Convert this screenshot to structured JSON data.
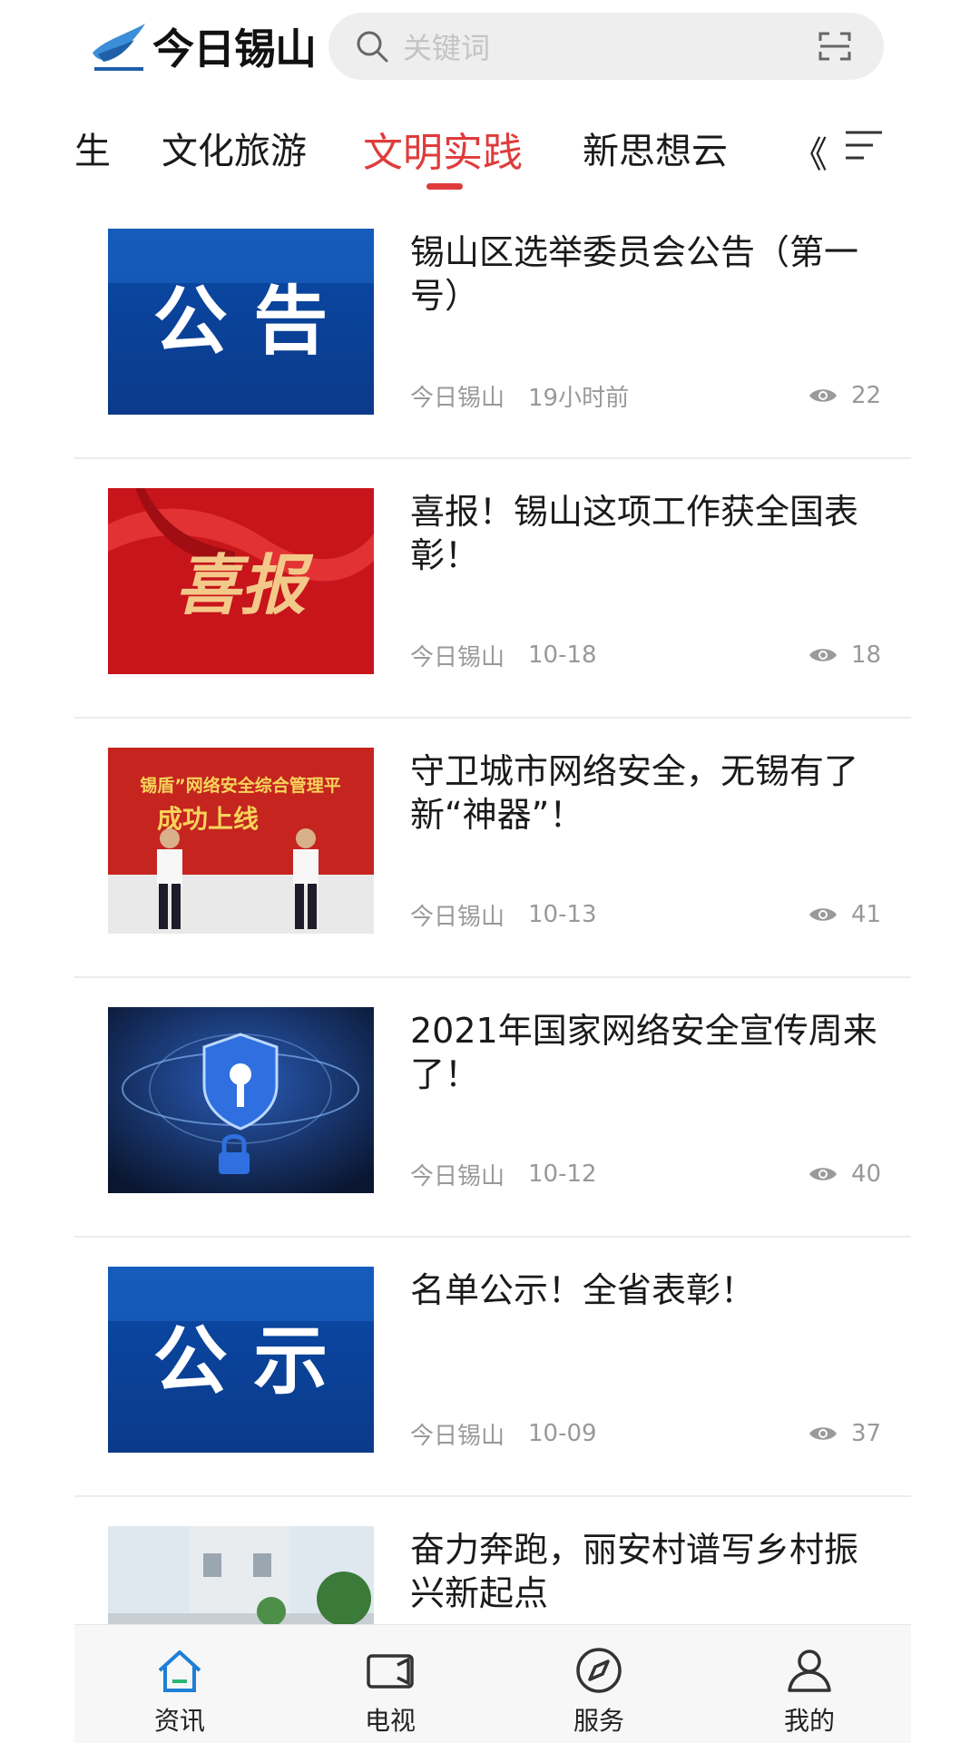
{
  "header": {
    "logo_text": "今日锡山",
    "search_placeholder": "关键词"
  },
  "tabs": [
    {
      "label": "生"
    },
    {
      "label": "文化旅游"
    },
    {
      "label": "文明实践",
      "active": true
    },
    {
      "label": "新思想云"
    }
  ],
  "tabs_collapse_glyph": "《",
  "articles": [
    {
      "title": "锡山区选举委员会公告（第一号）",
      "source": "今日锡山",
      "time": "19小时前",
      "views": "22",
      "thumb_text": "公 告",
      "thumb_style": "blue"
    },
    {
      "title": "喜报！锡山这项工作获全国表彰！",
      "source": "今日锡山",
      "time": "10-18",
      "views": "18",
      "thumb_text": "喜报",
      "thumb_style": "red"
    },
    {
      "title": "守卫城市网络安全，无锡有了新“神器”！",
      "source": "今日锡山",
      "time": "10-13",
      "views": "41",
      "thumb_text": "锡盾”网络安全综合管理平",
      "thumb_subtext": "成功上线",
      "thumb_style": "photo"
    },
    {
      "title": "2021年国家网络安全宣传周来了！",
      "source": "今日锡山",
      "time": "10-12",
      "views": "40",
      "thumb_style": "cyber"
    },
    {
      "title": "名单公示！全省表彰！",
      "source": "今日锡山",
      "time": "10-09",
      "views": "37",
      "thumb_text": "公 示",
      "thumb_style": "blue"
    },
    {
      "title": "奋力奔跑，丽安村谱写乡村振兴新起点",
      "source": "",
      "time": "",
      "views": "",
      "thumb_style": "house"
    }
  ],
  "bottom_nav": [
    {
      "label": "资讯",
      "icon": "home-icon",
      "active": true
    },
    {
      "label": "电视",
      "icon": "video-camera-icon"
    },
    {
      "label": "服务",
      "icon": "compass-icon"
    },
    {
      "label": "我的",
      "icon": "user-icon"
    }
  ],
  "colors": {
    "accent": "#e03b3b",
    "accent_blue": "#1e7fd6"
  }
}
